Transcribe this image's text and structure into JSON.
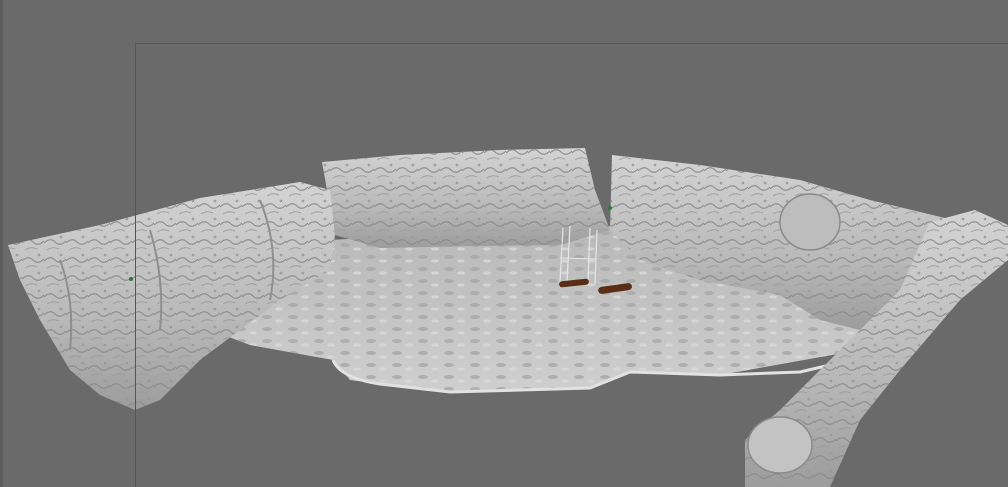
{
  "viewport": {
    "background_color": "#6a6a6a",
    "safe_frame_color": "#2f6e3e",
    "mesh_color": "#c9c9c9",
    "mesh_shadow_color": "#8e8e8e",
    "prop_color": "#5a2e16"
  },
  "scene": {
    "objects": [
      {
        "name": "rock-arena-terrain",
        "icon": "terrain-mesh"
      },
      {
        "name": "swing-frame",
        "icon": "swing-prop"
      },
      {
        "name": "log-left",
        "icon": "log-prop"
      },
      {
        "name": "log-right",
        "icon": "log-prop"
      }
    ]
  }
}
